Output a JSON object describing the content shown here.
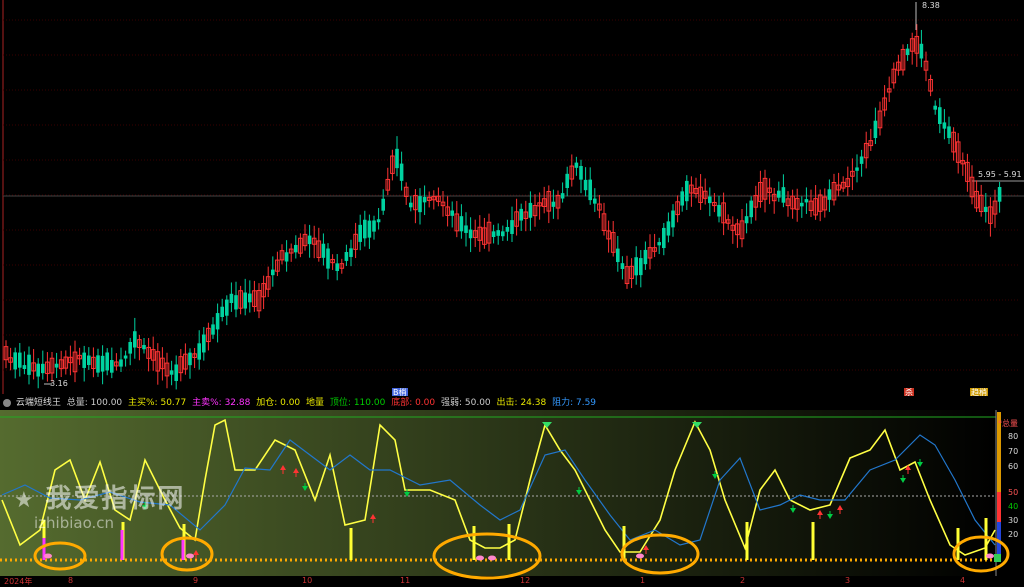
{
  "price_chart": {
    "high_label": "8.38",
    "low_label": "3.16",
    "current_range_label": "5.95 - 5.91",
    "markers": [
      {
        "text": "B梢",
        "bg": "#4466dd"
      },
      {
        "text": "杀",
        "bg": "#cc3322"
      },
      {
        "text": "趋梢",
        "bg": "#cc9900"
      }
    ]
  },
  "indicator_bar": {
    "title": "云端短线王",
    "items": [
      {
        "text": "总量: 100.00",
        "color": "#cccccc"
      },
      {
        "text": "主买%: 50.77",
        "color": "#e8e800"
      },
      {
        "text": "主卖%: 32.88",
        "color": "#ff33ff"
      },
      {
        "text": "加仓: 0.00",
        "color": "#e8e800"
      },
      {
        "text": "地量",
        "color": "#e8e800"
      },
      {
        "text": "顶位: 110.00",
        "color": "#00cc00"
      },
      {
        "text": "底部: 0.00",
        "color": "#ff3333"
      },
      {
        "text": "强弱: 50.00",
        "color": "#cccccc"
      },
      {
        "text": "出击: 24.38",
        "color": "#e8e800"
      },
      {
        "text": "阻力: 7.59",
        "color": "#3399ff"
      }
    ]
  },
  "right_axis": {
    "label": "*总量",
    "ticks": [
      "80",
      "70",
      "60",
      "50",
      "40",
      "30",
      "20"
    ]
  },
  "watermark": {
    "title": "我爱指标网",
    "url": "izhibiao.cn"
  },
  "date_labels": [
    "2024年",
    "8",
    "9",
    "10",
    "11",
    "12",
    "1",
    "2",
    "3",
    "4"
  ],
  "colors": {
    "up": "#ff3333",
    "down": "#00d2a0",
    "yellow_line": "#ffff44",
    "blue_line": "#2277cc",
    "circle": "#ffaa00",
    "dots": "#ffaa00"
  },
  "chart_data": {
    "type": "line",
    "title": "云端短线王",
    "price_high": 8.38,
    "price_low": 3.16,
    "y_ticks": [
      80,
      70,
      60,
      50,
      40,
      30,
      20
    ],
    "series": [
      {
        "name": "主买%",
        "values_last": 50.77
      },
      {
        "name": "主卖%",
        "values_last": 32.88
      },
      {
        "name": "出击",
        "values_last": 24.38
      },
      {
        "name": "阻力",
        "values_last": 7.59
      }
    ]
  }
}
